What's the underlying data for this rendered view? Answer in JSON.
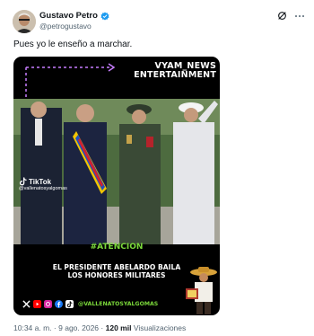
{
  "author": {
    "name": "Gustavo Petro",
    "handle": "@petrogustavo",
    "verified": true
  },
  "post": {
    "text": "Pues yo le enseño a marchar."
  },
  "media": {
    "channel_line1": "VYAM_NEWS",
    "channel_line2": "ENTERTAINMENT",
    "tiktok_label": "TikTok",
    "tiktok_handle": "@vallenatosyalgomas",
    "hashtag": "#ATENCION",
    "headline_line1": "EL PRESIDENTE ABELARDO BAILA",
    "headline_line2": "LOS HONORES MILITARES",
    "social_handle": "@VALLENATOSYALGOMAS",
    "social_icons": [
      "x-icon",
      "youtube-icon",
      "instagram-icon",
      "facebook-icon",
      "tiktok-icon"
    ]
  },
  "meta": {
    "time": "10:34 a. m.",
    "separator": "·",
    "date": "9 ago. 2026",
    "views_count": "120 mil",
    "views_label": "Visualizaciones"
  },
  "colors": {
    "accent_green": "#7bd93a",
    "verified_blue": "#1d9bf0",
    "muted_text": "#536471"
  }
}
